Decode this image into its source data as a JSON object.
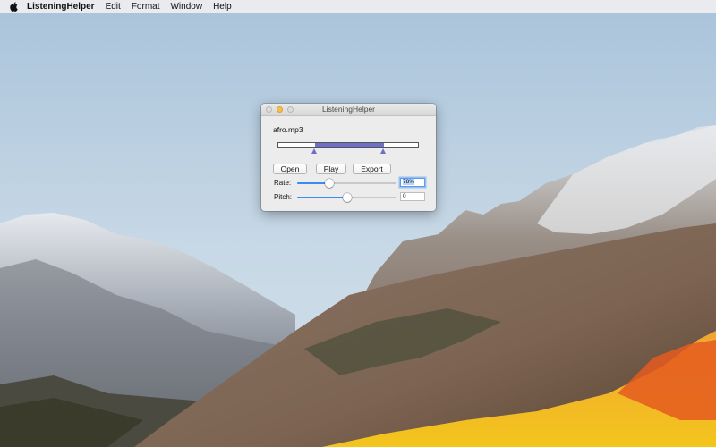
{
  "menubar": {
    "apple_icon": "apple-logo-icon",
    "app_name": "ListeningHelper",
    "items": [
      "Edit",
      "Format",
      "Window",
      "Help"
    ]
  },
  "window": {
    "title": "ListeningHelper",
    "filename": "afro.mp3",
    "range": {
      "start": 0.26,
      "end": 0.75,
      "playhead": 0.59
    },
    "buttons": {
      "open": "Open",
      "play": "Play",
      "export": "Export"
    },
    "rate": {
      "label": "Rate:",
      "value": "78%",
      "slider_fraction": 0.32
    },
    "pitch": {
      "label": "Pitch:",
      "value": "0",
      "slider_fraction": 0.5
    }
  },
  "colors": {
    "range_fill": "#6e6fc8",
    "slider_accent": "#3d8bf0",
    "minimize_button": "#f6be4f"
  }
}
